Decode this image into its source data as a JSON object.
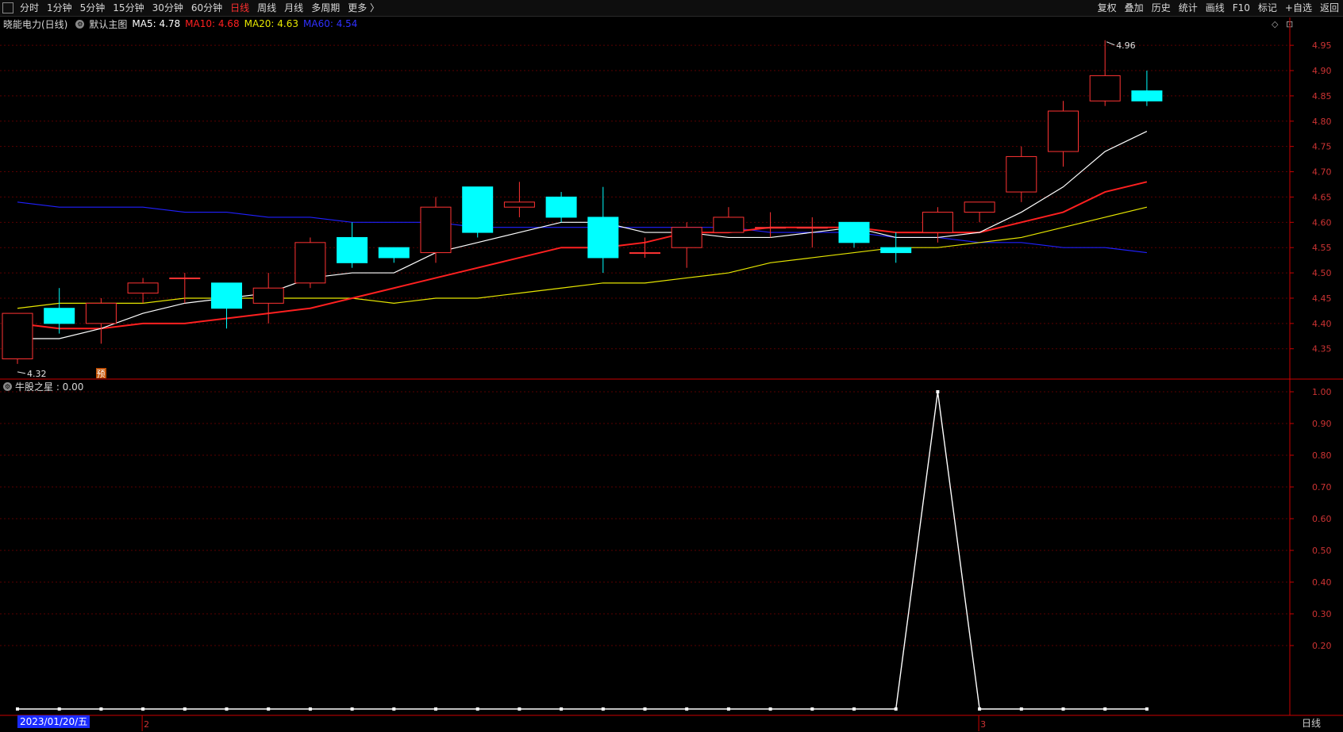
{
  "toolbar": {
    "left_items": [
      "分时",
      "1分钟",
      "5分钟",
      "15分钟",
      "30分钟",
      "60分钟",
      "日线",
      "周线",
      "月线",
      "多周期",
      "更多 〉"
    ],
    "active_item": "日线",
    "right_items": [
      "复权",
      "叠加",
      "历史",
      "统计",
      "画线",
      "F10",
      "标记",
      "+自选",
      "返回"
    ]
  },
  "info": {
    "stock_name": "晓能电力(日线)",
    "main_chart": "默认主图",
    "ma5": "MA5: 4.78",
    "ma10": "MA10: 4.68",
    "ma20": "MA20: 4.63",
    "ma60": "MA60: 4.54"
  },
  "sub_info": {
    "indicator": "牛股之星 : 0.00"
  },
  "labels": {
    "high": "4.96",
    "low": "4.32",
    "pre_marker": "预",
    "date": "2023/01/20/五",
    "period": "日线",
    "month_markers": [
      "2",
      "3"
    ]
  },
  "colors": {
    "up": "#ff3333",
    "down": "#00ffff",
    "ma5": "#ffffff",
    "ma10": "#ff2020",
    "ma20": "#e6e600",
    "ma60": "#2020ff",
    "grid": "#5a0000",
    "axis": "#cc0000"
  },
  "chart_data": [
    {
      "type": "candlestick",
      "y_ticks": [
        "4.95",
        "4.90",
        "4.85",
        "4.80",
        "4.75",
        "4.70",
        "4.65",
        "4.60",
        "4.55",
        "4.50",
        "4.45",
        "4.40",
        "4.35"
      ],
      "ylim": [
        4.29,
        4.98
      ],
      "candles": [
        {
          "o": 4.33,
          "h": 4.42,
          "l": 4.32,
          "c": 4.42
        },
        {
          "o": 4.43,
          "h": 4.47,
          "l": 4.38,
          "c": 4.4
        },
        {
          "o": 4.4,
          "h": 4.45,
          "l": 4.36,
          "c": 4.44
        },
        {
          "o": 4.46,
          "h": 4.49,
          "l": 4.44,
          "c": 4.48
        },
        {
          "o": 4.49,
          "h": 4.5,
          "l": 4.44,
          "c": 4.49
        },
        {
          "o": 4.48,
          "h": 4.48,
          "l": 4.39,
          "c": 4.43
        },
        {
          "o": 4.44,
          "h": 4.5,
          "l": 4.4,
          "c": 4.47
        },
        {
          "o": 4.48,
          "h": 4.57,
          "l": 4.47,
          "c": 4.56
        },
        {
          "o": 4.57,
          "h": 4.6,
          "l": 4.51,
          "c": 4.52
        },
        {
          "o": 4.55,
          "h": 4.55,
          "l": 4.52,
          "c": 4.53
        },
        {
          "o": 4.54,
          "h": 4.65,
          "l": 4.52,
          "c": 4.63
        },
        {
          "o": 4.67,
          "h": 4.67,
          "l": 4.57,
          "c": 4.58
        },
        {
          "o": 4.63,
          "h": 4.68,
          "l": 4.61,
          "c": 4.64
        },
        {
          "o": 4.65,
          "h": 4.66,
          "l": 4.6,
          "c": 4.61
        },
        {
          "o": 4.61,
          "h": 4.67,
          "l": 4.5,
          "c": 4.53
        },
        {
          "o": 4.54,
          "h": 4.57,
          "l": 4.53,
          "c": 4.54
        },
        {
          "o": 4.55,
          "h": 4.6,
          "l": 4.51,
          "c": 4.59
        },
        {
          "o": 4.58,
          "h": 4.63,
          "l": 4.58,
          "c": 4.61
        },
        {
          "o": 4.59,
          "h": 4.62,
          "l": 4.57,
          "c": 4.59
        },
        {
          "o": 4.59,
          "h": 4.61,
          "l": 4.55,
          "c": 4.59
        },
        {
          "o": 4.6,
          "h": 4.6,
          "l": 4.55,
          "c": 4.56
        },
        {
          "o": 4.55,
          "h": 4.58,
          "l": 4.52,
          "c": 4.54
        },
        {
          "o": 4.58,
          "h": 4.63,
          "l": 4.56,
          "c": 4.62
        },
        {
          "o": 4.62,
          "h": 4.64,
          "l": 4.6,
          "c": 4.64
        },
        {
          "o": 4.66,
          "h": 4.75,
          "l": 4.64,
          "c": 4.73
        },
        {
          "o": 4.74,
          "h": 4.84,
          "l": 4.71,
          "c": 4.82
        },
        {
          "o": 4.84,
          "h": 4.96,
          "l": 4.83,
          "c": 4.89
        },
        {
          "o": 4.86,
          "h": 4.9,
          "l": 4.83,
          "c": 4.84
        }
      ],
      "ma5": [
        4.37,
        4.37,
        4.39,
        4.42,
        4.44,
        4.45,
        4.46,
        4.49,
        4.5,
        4.5,
        4.54,
        4.56,
        4.58,
        4.6,
        4.6,
        4.58,
        4.58,
        4.57,
        4.57,
        4.58,
        4.59,
        4.57,
        4.57,
        4.58,
        4.62,
        4.67,
        4.74,
        4.78
      ],
      "ma10": [
        4.4,
        4.39,
        4.39,
        4.4,
        4.4,
        4.41,
        4.42,
        4.43,
        4.45,
        4.47,
        4.49,
        4.51,
        4.53,
        4.55,
        4.55,
        4.56,
        4.58,
        4.58,
        4.59,
        4.59,
        4.59,
        4.58,
        4.58,
        4.58,
        4.6,
        4.62,
        4.66,
        4.68
      ],
      "ma20": [
        4.43,
        4.44,
        4.44,
        4.44,
        4.45,
        4.45,
        4.45,
        4.45,
        4.45,
        4.44,
        4.45,
        4.45,
        4.46,
        4.47,
        4.48,
        4.48,
        4.49,
        4.5,
        4.52,
        4.53,
        4.54,
        4.55,
        4.55,
        4.56,
        4.57,
        4.59,
        4.61,
        4.63
      ],
      "ma60": [
        4.64,
        4.63,
        4.63,
        4.63,
        4.62,
        4.62,
        4.61,
        4.61,
        4.6,
        4.6,
        4.6,
        4.59,
        4.59,
        4.59,
        4.59,
        4.59,
        4.59,
        4.59,
        4.58,
        4.58,
        4.58,
        4.57,
        4.57,
        4.56,
        4.56,
        4.55,
        4.55,
        4.54
      ]
    },
    {
      "type": "line",
      "name": "牛股之星",
      "y_ticks": [
        "1.00",
        "0.90",
        "0.80",
        "0.70",
        "0.60",
        "0.50",
        "0.40",
        "0.30",
        "0.20"
      ],
      "ylim": [
        -0.02,
        1.04
      ],
      "values": [
        0,
        0,
        0,
        0,
        0,
        0,
        0,
        0,
        0,
        0,
        0,
        0,
        0,
        0,
        0,
        0,
        0,
        0,
        0,
        0,
        0,
        0,
        1,
        0,
        0,
        0,
        0,
        0
      ]
    }
  ]
}
